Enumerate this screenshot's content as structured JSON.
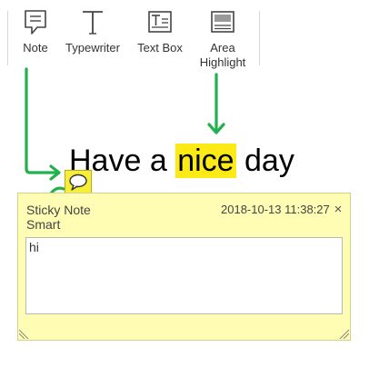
{
  "toolbar": {
    "tools": [
      {
        "label": "Note",
        "icon": "note-icon"
      },
      {
        "label": "Typewriter",
        "icon": "typewriter-icon"
      },
      {
        "label": "Text Box",
        "icon": "text-box-icon"
      },
      {
        "label": "Area\nHighlight",
        "icon": "area-highlight-icon"
      }
    ]
  },
  "document": {
    "text_before": "Have a ",
    "highlighted_text": "nice",
    "text_after": " day",
    "highlight_color": "#fcea17"
  },
  "sticky_note": {
    "title": "Sticky Note\nSmart",
    "date": "2018-10-13 11:38:27",
    "close_glyph": "×",
    "content": "hi",
    "color": "#fffdb4",
    "icon_color": "#f7ee3a"
  },
  "annotation": {
    "arrow_color": "#22b14c"
  }
}
